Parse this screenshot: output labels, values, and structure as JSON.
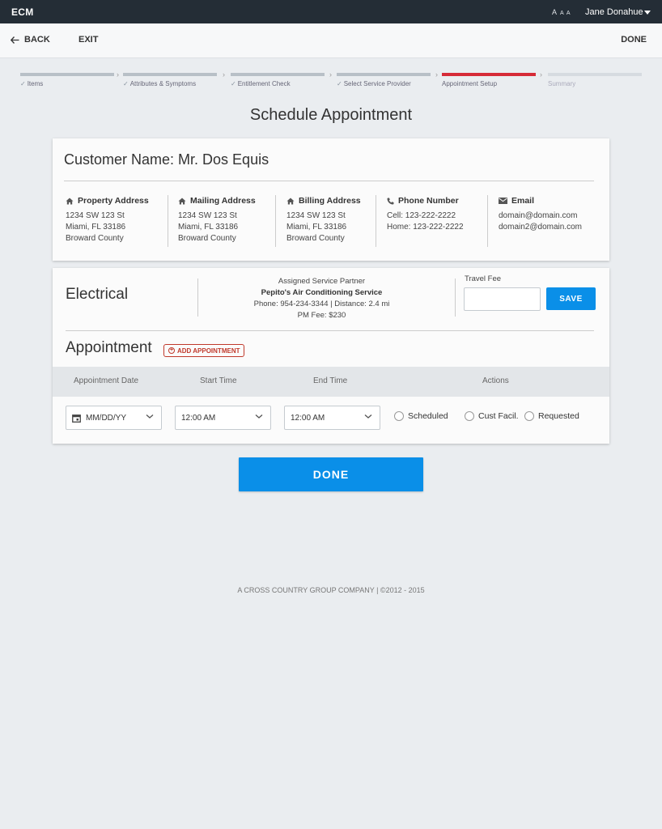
{
  "app": {
    "brand": "ECM",
    "text_size_label": "A A A",
    "user_name": "Jane Donahue"
  },
  "nav": {
    "back_label": "BACK",
    "exit_label": "EXIT",
    "done_label": "DONE"
  },
  "steps": [
    {
      "label": "Items",
      "state": "done"
    },
    {
      "label": "Attributes & Symptoms",
      "state": "done"
    },
    {
      "label": "Entitlement Check",
      "state": "done"
    },
    {
      "label": "Select Service Provider",
      "state": "done"
    },
    {
      "label": "Appointment Setup",
      "state": "active"
    },
    {
      "label": "Summary",
      "state": "future"
    }
  ],
  "page_title": "Schedule Appointment",
  "customer": {
    "name": "Customer Name: Mr. Dos Equis",
    "property": {
      "heading": "Property Address",
      "line1": "1234 SW 123 St",
      "line2": "Miami, FL  33186",
      "line3": "Broward County"
    },
    "mailing": {
      "heading": "Mailing Address",
      "line1": "1234 SW 123 St",
      "line2": "Miami, FL  33186",
      "line3": "Broward County"
    },
    "billing": {
      "heading": "Billing Address",
      "line1": "1234 SW 123 St",
      "line2": "Miami, FL  33186",
      "line3": "Broward County"
    },
    "phone": {
      "heading": "Phone Number",
      "cell": "Cell: 123-222-2222",
      "home": "Home: 123-222-2222"
    },
    "email": {
      "heading": "Email",
      "email1": "domain@domain.com",
      "email2": "domain2@domain.com"
    }
  },
  "service": {
    "type": "Electrical",
    "partner_label": "Assigned Service Partner",
    "partner_name": "Pepito's Air Conditioning Service",
    "partner_contact": "Phone: 954-234-3344  |  Distance: 2.4 mi",
    "pm_fee": "PM Fee: $230",
    "travel_fee_label": "Travel Fee",
    "travel_fee_value": "",
    "save_label": "SAVE"
  },
  "appointment": {
    "title": "Appointment",
    "add_label": "ADD APPOINTMENT",
    "columns": {
      "date": "Appointment Date",
      "start": "Start Time",
      "end": "End Time",
      "actions": "Actions"
    },
    "row": {
      "date": "MM/DD/YY",
      "start": "12:00 AM",
      "end": "12:00 AM",
      "options": [
        "Scheduled",
        "Cust Facil.",
        "Requested"
      ]
    }
  },
  "done_button": "DONE",
  "footer": "A CROSS COUNTRY GROUP COMPANY | ©2012 - 2015",
  "colors": {
    "topbar": "#242d36",
    "primary": "#0a8fe8",
    "active_step": "#d62b37",
    "accent_red": "#c0392b"
  }
}
